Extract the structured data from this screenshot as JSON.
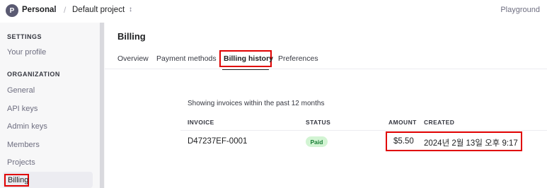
{
  "topbar": {
    "avatar_letter": "P",
    "org": "Personal",
    "separator": "/",
    "project": "Default project",
    "playground": "Playground"
  },
  "sidebar": {
    "settings_heading": "SETTINGS",
    "settings_items": [
      "Your profile"
    ],
    "organization_heading": "ORGANIZATION",
    "organization_items": [
      "General",
      "API keys",
      "Admin keys",
      "Members",
      "Projects",
      "Billing"
    ],
    "active_item": "Billing"
  },
  "main": {
    "title": "Billing",
    "tabs": [
      "Overview",
      "Payment methods",
      "Billing history",
      "Preferences"
    ],
    "active_tab": "Billing history",
    "caption": "Showing invoices within the past 12 months",
    "columns": [
      "INVOICE",
      "STATUS",
      "AMOUNT",
      "CREATED"
    ],
    "rows": [
      {
        "invoice": "D47237EF-0001",
        "status": "Paid",
        "amount": "$5.50",
        "created": "2024년 2월 13일 오후 9:17"
      }
    ]
  },
  "colors": {
    "highlight": "#e00000",
    "sidebar_bg": "#f7f7f8",
    "paid_badge_bg": "#d2f4d3",
    "paid_badge_text": "#1a7f37"
  }
}
